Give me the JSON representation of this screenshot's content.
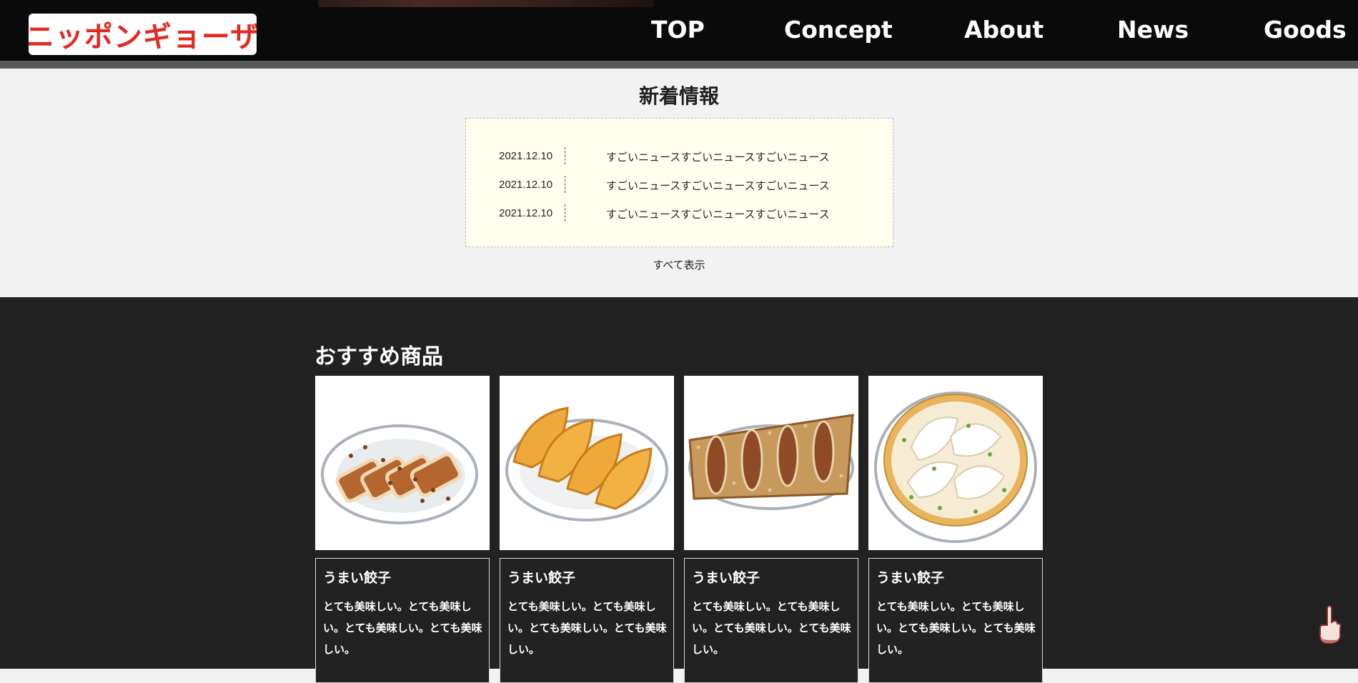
{
  "header": {
    "logo_text": "ニッポンギョーザ",
    "nav": [
      {
        "label": "TOP"
      },
      {
        "label": "Concept"
      },
      {
        "label": "About"
      },
      {
        "label": "News"
      },
      {
        "label": "Goods"
      }
    ]
  },
  "news": {
    "title": "新着情報",
    "items": [
      {
        "date": "2021.12.10",
        "text": "すごいニュースすごいニュースすごいニュース"
      },
      {
        "date": "2021.12.10",
        "text": "すごいニュースすごいニュースすごいニュース"
      },
      {
        "date": "2021.12.10",
        "text": "すごいニュースすごいニュースすごいニュース"
      }
    ],
    "show_all": "すべて表示"
  },
  "products": {
    "title": "おすすめ商品",
    "items": [
      {
        "name": "うまい餃子",
        "description": "とても美味しい。とても美味しい。とても美味しい。とても美味しい。",
        "image": "grilled-gyoza-illustration"
      },
      {
        "name": "うまい餃子",
        "description": "とても美味しい。とても美味しい。とても美味しい。とても美味しい。",
        "image": "fried-gyoza-illustration"
      },
      {
        "name": "うまい餃子",
        "description": "とても美味しい。とても美味しい。とても美味しい。とても美味しい。",
        "image": "winged-gyoza-illustration"
      },
      {
        "name": "うまい餃子",
        "description": "とても美味しい。とても美味しい。とても美味しい。とても美味しい。",
        "image": "soup-gyoza-illustration"
      }
    ]
  },
  "icons": {
    "scroll_top": "pointing-finger-icon"
  },
  "colors": {
    "brand_red": "#e12a22",
    "header_bg": "#0a0a0a",
    "products_bg": "#222222",
    "news_box_bg": "#ffffee"
  }
}
